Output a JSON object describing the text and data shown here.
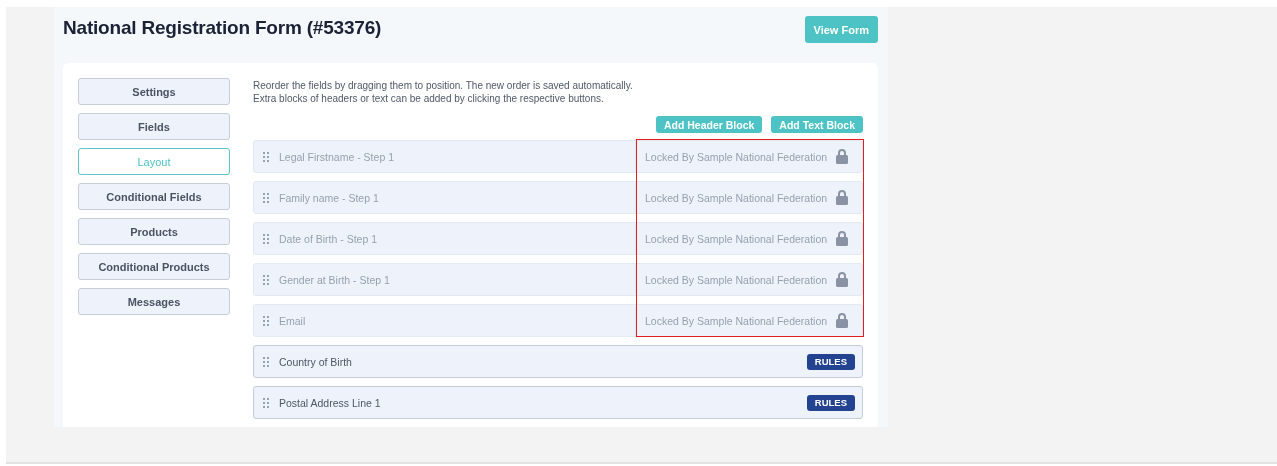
{
  "page": {
    "title": "National Registration Form (#53376)",
    "view_button": "View Form"
  },
  "sidebar": {
    "items": [
      {
        "label": "Settings",
        "selected": false
      },
      {
        "label": "Fields",
        "selected": false
      },
      {
        "label": "Layout",
        "selected": true
      },
      {
        "label": "Conditional Fields",
        "selected": false
      },
      {
        "label": "Products",
        "selected": false
      },
      {
        "label": "Conditional Products",
        "selected": false
      },
      {
        "label": "Messages",
        "selected": false
      }
    ]
  },
  "instructions": [
    "Reorder the fields by dragging them to position. The new order is saved automatically.",
    "Extra blocks of headers or text can be added by clicking the respective buttons."
  ],
  "buttons": [
    "Add Header Block",
    "Add Text Block"
  ],
  "fields": {
    "highlight_locked": true,
    "rows": [
      {
        "label": "Legal Firstname - Step 1",
        "kind": "locked",
        "note": "Locked By Sample National Federation"
      },
      {
        "label": "Family name - Step 1",
        "kind": "locked",
        "note": "Locked By Sample National Federation"
      },
      {
        "label": "Date of Birth - Step 1",
        "kind": "locked",
        "note": "Locked By Sample National Federation"
      },
      {
        "label": "Gender at Birth - Step 1",
        "kind": "locked",
        "note": "Locked By Sample National Federation"
      },
      {
        "label": "Email",
        "kind": "locked",
        "note": "Locked By Sample National Federation"
      },
      {
        "label": "Country of Birth",
        "kind": "rules",
        "action": "RULES"
      },
      {
        "label": "Postal Address Line 1",
        "kind": "rules",
        "action": "RULES"
      }
    ]
  }
}
